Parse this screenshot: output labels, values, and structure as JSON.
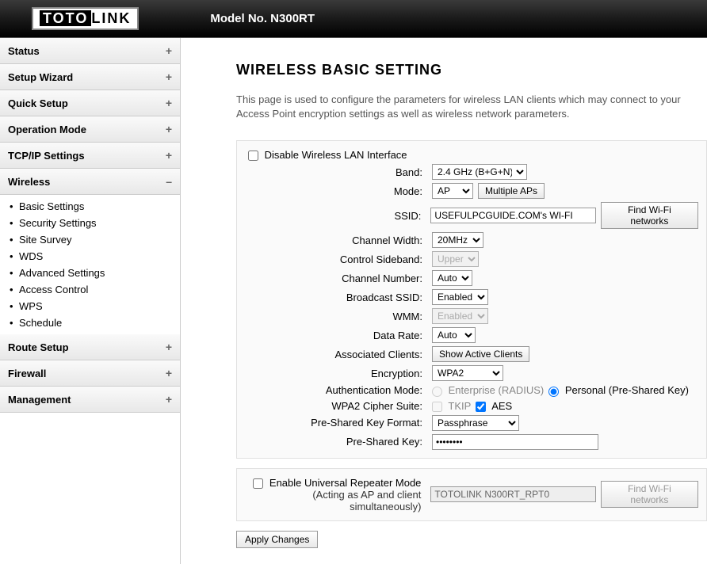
{
  "header": {
    "brand_prefix": "TOTO",
    "brand_suffix": "LINK",
    "model_label": "Model No. N300RT"
  },
  "sidebar": {
    "items": [
      {
        "label": "Status",
        "expanded": false
      },
      {
        "label": "Setup Wizard",
        "expanded": false
      },
      {
        "label": "Quick Setup",
        "expanded": false
      },
      {
        "label": "Operation Mode",
        "expanded": false
      },
      {
        "label": "TCP/IP Settings",
        "expanded": false
      },
      {
        "label": "Wireless",
        "expanded": true,
        "children": [
          "Basic Settings",
          "Security Settings",
          "Site Survey",
          "WDS",
          "Advanced Settings",
          "Access Control",
          "WPS",
          "Schedule"
        ]
      },
      {
        "label": "Route Setup",
        "expanded": false
      },
      {
        "label": "Firewall",
        "expanded": false
      },
      {
        "label": "Management",
        "expanded": false
      }
    ]
  },
  "page": {
    "title": "WIRELESS BASIC SETTING",
    "description": "This page is used to configure the parameters for wireless LAN clients which may connect to your Access Point encryption settings as well as wireless network parameters."
  },
  "form": {
    "disable_wlan_label": "Disable Wireless LAN Interface",
    "band": {
      "label": "Band:",
      "value": "2.4 GHz (B+G+N)"
    },
    "mode": {
      "label": "Mode:",
      "value": "AP",
      "multiple_aps_btn": "Multiple APs"
    },
    "ssid": {
      "label": "SSID:",
      "value": "USEFULPCGUIDE.COM's WI-FI",
      "find_btn": "Find Wi-Fi networks"
    },
    "channel_width": {
      "label": "Channel Width:",
      "value": "20MHz"
    },
    "control_sideband": {
      "label": "Control Sideband:",
      "value": "Upper"
    },
    "channel_number": {
      "label": "Channel Number:",
      "value": "Auto"
    },
    "broadcast_ssid": {
      "label": "Broadcast SSID:",
      "value": "Enabled"
    },
    "wmm": {
      "label": "WMM:",
      "value": "Enabled"
    },
    "data_rate": {
      "label": "Data Rate:",
      "value": "Auto"
    },
    "associated_clients": {
      "label": "Associated Clients:",
      "btn": "Show Active Clients"
    },
    "encryption": {
      "label": "Encryption:",
      "value": "WPA2"
    },
    "auth_mode": {
      "label": "Authentication Mode:",
      "enterprise": "Enterprise (RADIUS)",
      "personal": "Personal (Pre-Shared Key)"
    },
    "cipher": {
      "label": "WPA2 Cipher Suite:",
      "tkip": "TKIP",
      "aes": "AES"
    },
    "psk_format": {
      "label": "Pre-Shared Key Format:",
      "value": "Passphrase"
    },
    "psk": {
      "label": "Pre-Shared Key:",
      "value": "••••••••"
    },
    "repeater": {
      "enable_label": "Enable Universal Repeater Mode",
      "sub_label": "(Acting as AP and client simultaneously)",
      "ssid_value": "TOTOLINK N300RT_RPT0",
      "find_btn": "Find Wi-Fi networks"
    },
    "apply_btn": "Apply Changes"
  }
}
